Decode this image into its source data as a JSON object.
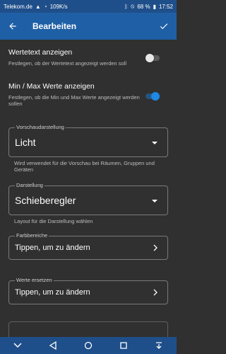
{
  "status_bar": {
    "carrier": "Telekom.de",
    "speed": "109K/s",
    "battery": "68 %",
    "time": "17:52"
  },
  "appbar": {
    "title": "Bearbeiten"
  },
  "settings": {
    "wertetext": {
      "title": "Wertetext anzeigen",
      "subtitle": "Festlegen, ob der Wertetext angezeigt werden soll",
      "enabled": false
    },
    "minmax": {
      "title": "Min / Max Werte anzeigen",
      "subtitle": "Festlegen, ob die Min und Max Werte angezeigt werden sollen",
      "enabled": true
    }
  },
  "vorschau": {
    "label": "Vorschaudarstellung",
    "value": "Licht",
    "helper": "Wird verwendet für die Vorschau bei Räumen, Gruppen und Geräten"
  },
  "darstellung": {
    "label": "Darstellung",
    "value": "Schieberegler",
    "helper": "Layout für die Darstellung wählen"
  },
  "farbbereiche": {
    "label": "Farbbereiche",
    "value": "Tippen, um zu ändern"
  },
  "werte_ersetzen": {
    "label": "Werte ersetzen",
    "value": "Tippen, um zu ändern"
  }
}
